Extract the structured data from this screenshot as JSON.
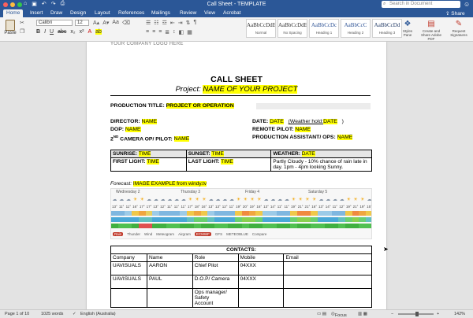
{
  "window": {
    "title": "Call Sheet - TEMPLATE",
    "search_placeholder": "Search in Document"
  },
  "ribbon_tabs": [
    "Home",
    "Insert",
    "Draw",
    "Design",
    "Layout",
    "References",
    "Mailings",
    "Review",
    "View",
    "Acrobat"
  ],
  "share_label": "Share",
  "ribbon": {
    "paste_label": "Paste",
    "font_name": "Calibri",
    "font_size": "12",
    "styles": [
      {
        "sample": "AaBbCcDdE",
        "name": "Normal"
      },
      {
        "sample": "AaBbCcDdE",
        "name": "No Spacing"
      },
      {
        "sample": "AaBbCcDc",
        "name": "Heading 1"
      },
      {
        "sample": "AaBbCcC",
        "name": "Heading 2"
      },
      {
        "sample": "AaBbCcDd",
        "name": "Heading 3"
      }
    ],
    "styles_pane": "Styles Pane",
    "create_share": "Create and Share Adobe PDF",
    "request_sig": "Request Signatures"
  },
  "document": {
    "logo_text": "YOUR COMPANY LOGO HERE",
    "title": "CALL SHEET",
    "project_label": "Project:",
    "project_value": "NAME OF YOUR PROJECT",
    "production_title_label": "PRODUCTION TITLE:",
    "production_title_value": "PROJECT OR OPERATION",
    "director_label": "DIRECTOR:",
    "director_value": "NAME",
    "dop_label": "DOP:",
    "dop_value": "NAME",
    "camera_label_pre": "2",
    "camera_label_sup": "ND",
    "camera_label_post": " CAMERA OP/ PILOT:",
    "camera_value": "NAME",
    "date_label": "DATE:",
    "date_value": "DATE",
    "weather_hold_label": "(Weather hold:",
    "weather_hold_value": "DATE",
    "weather_hold_close": ")",
    "remote_pilot_label": "REMOTE PILOT:",
    "remote_pilot_value": "NAME",
    "prod_asst_label": "PRODUCTION ASSISTANT/ OPS:",
    "prod_asst_value": "NAME",
    "sunrise_label": "SUNRISE:",
    "sunrise_value": "TIME",
    "sunset_label": "SUNSET:",
    "sunset_value": "TIME",
    "weather_label": "WEATHER:",
    "weather_value": "DATE",
    "first_light_label": "FIRST LIGHT:",
    "first_light_value": "TIME",
    "last_light_label": "LAST LIGHT:",
    "last_light_value": "TIME",
    "weather_desc": "Partly Cloudy - 10% chance of rain late in day. 1pm - 4pm looking Sunny.",
    "forecast_label": "Forecast:",
    "forecast_value": "IMAGE EXAMPLE from windy.tv",
    "forecast_days": [
      "Wednesday 2",
      "Thursday 3",
      "Friday 4",
      "Saturday 5"
    ],
    "forecast_temps": [
      "13°",
      "11°",
      "11°",
      "16°",
      "17°",
      "17°",
      "13°",
      "12°",
      "11°",
      "11°",
      "11°",
      "17°",
      "18°",
      "16°",
      "13°",
      "13°",
      "12°",
      "11°",
      "19°",
      "20°",
      "19°",
      "16°",
      "13°",
      "14°",
      "11°",
      "11°",
      "19°",
      "21°",
      "21°",
      "16°",
      "13°",
      "14°",
      "11°",
      "12°",
      "19°",
      "21°",
      "19°",
      "15°"
    ],
    "forecast_legend": [
      "Rain",
      "Thunder",
      "Wind",
      "Meteogram",
      "Airgram",
      "ECMWF",
      "GFS",
      "METEOBLUE",
      "Compare"
    ],
    "contacts_title": "CONTACTS:",
    "contacts_headers": [
      "Company",
      "Name",
      "Role",
      "Mobile",
      "Email"
    ],
    "contacts_rows": [
      [
        "UAVISUALS",
        "AARON",
        "Chief Pilot",
        "04XXX",
        ""
      ],
      [
        "UAVISUALS",
        "PAUL",
        "D.O.P/ Camera",
        "04XXX",
        ""
      ],
      [
        "",
        "",
        "Ops manager/ Safety",
        "",
        ""
      ],
      [
        "",
        "",
        "Account",
        "",
        ""
      ]
    ]
  },
  "statusbar": {
    "page": "Page 1 of 10",
    "words": "1025 words",
    "language": "English (Australia)",
    "focus": "Focus",
    "zoom": "142%"
  }
}
